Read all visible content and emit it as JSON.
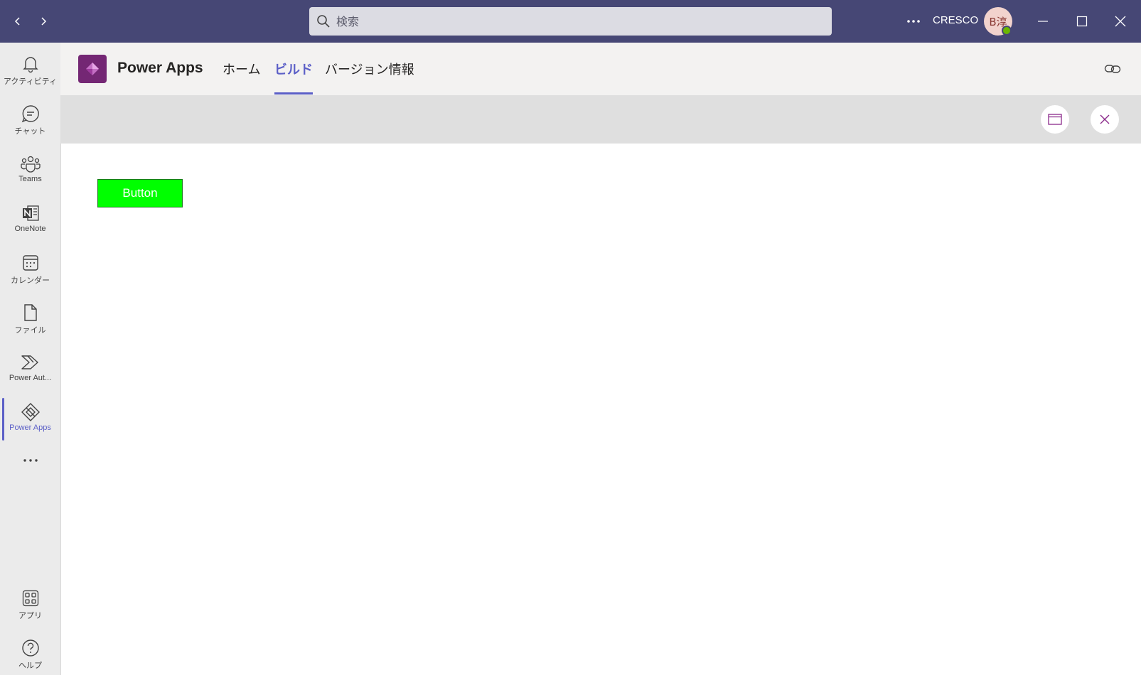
{
  "titlebar": {
    "search_placeholder": "検索",
    "org_name": "CRESCO",
    "avatar_text": "B淳"
  },
  "rail": {
    "items": [
      {
        "label": "アクティビティ",
        "icon": "bell-icon"
      },
      {
        "label": "チャット",
        "icon": "chat-icon"
      },
      {
        "label": "Teams",
        "icon": "teams-icon"
      },
      {
        "label": "OneNote",
        "icon": "onenote-icon"
      },
      {
        "label": "カレンダー",
        "icon": "calendar-icon"
      },
      {
        "label": "ファイル",
        "icon": "file-icon"
      },
      {
        "label": "Power Aut...",
        "icon": "power-automate-icon"
      },
      {
        "label": "Power Apps",
        "icon": "power-apps-icon"
      }
    ],
    "bottom_items": [
      {
        "label": "アプリ",
        "icon": "apps-icon"
      },
      {
        "label": "ヘルプ",
        "icon": "help-icon"
      }
    ]
  },
  "app_header": {
    "app_name": "Power Apps",
    "tabs": [
      {
        "label": "ホーム"
      },
      {
        "label": "ビルド"
      },
      {
        "label": "バージョン情報"
      }
    ],
    "active_tab": "ビルド"
  },
  "canvas": {
    "button_label": "Button",
    "button_color": "#00ff00"
  },
  "colors": {
    "titlebar_bg": "#464775",
    "accent": "#5b5fc7",
    "powerapps_brand": "#742774"
  }
}
